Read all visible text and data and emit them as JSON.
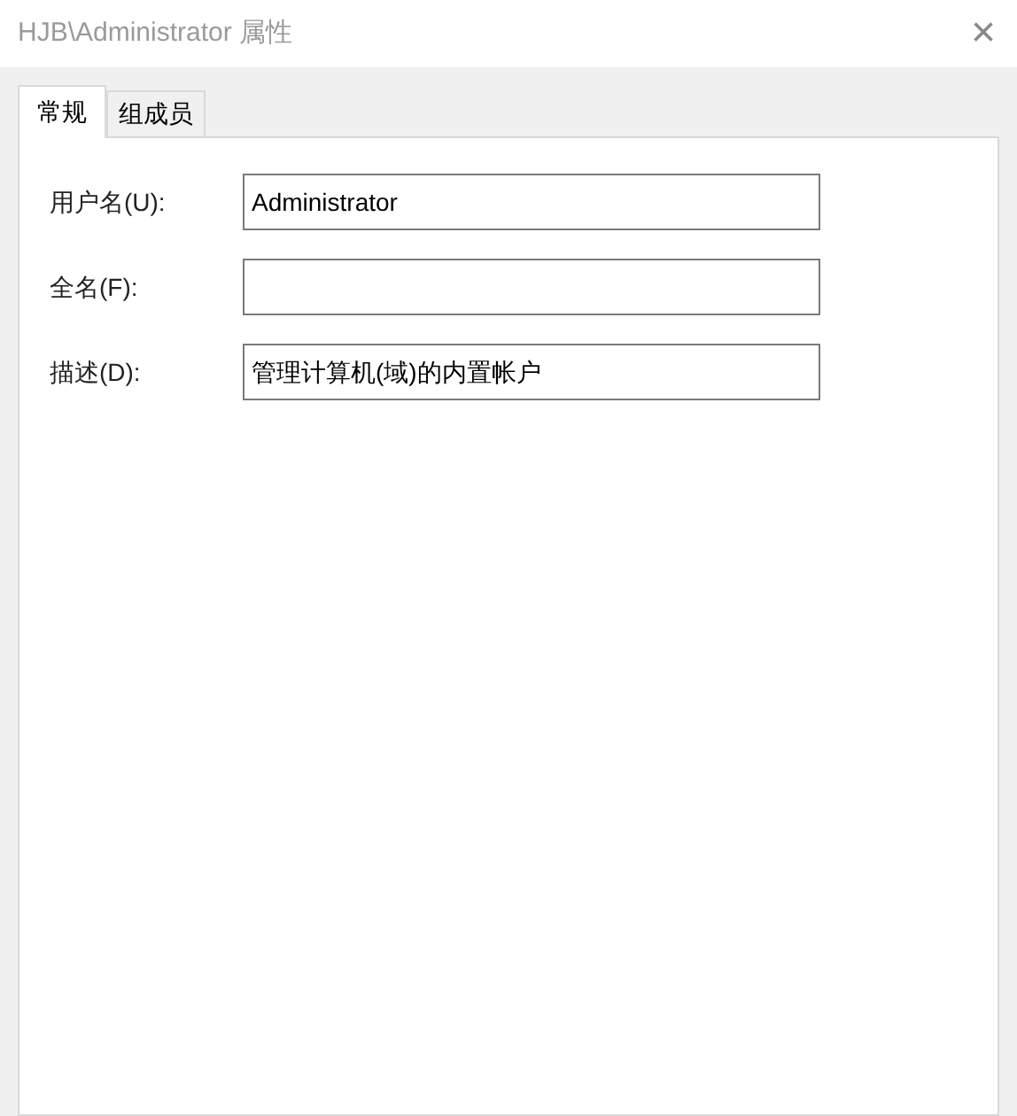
{
  "window": {
    "title": "HJB\\Administrator 属性",
    "close": "×"
  },
  "tabs": [
    {
      "label": "常规",
      "selected": true
    },
    {
      "label": "组成员",
      "selected": false
    }
  ],
  "fields": [
    {
      "label": "用户名(U):",
      "value": "Administrator"
    },
    {
      "label": "全名(F):"
    },
    {
      "label": "描述(D):",
      "value": "管理计算机(域)的内置帐户"
    }
  ]
}
